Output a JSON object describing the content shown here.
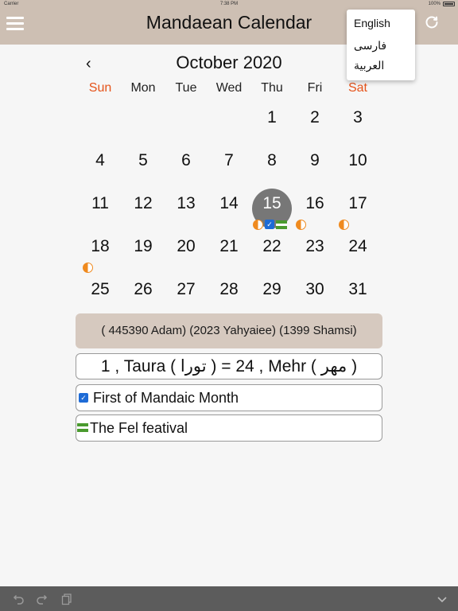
{
  "status_bar": {
    "carrier": "Carrier",
    "time": "7:38 PM",
    "battery": "100%"
  },
  "navbar": {
    "title": "Mandaean Calendar",
    "menu_icon": "hamburger-menu-icon",
    "refresh_icon": "refresh-icon"
  },
  "language_menu": {
    "items": [
      "English",
      "فارسی",
      "العربية"
    ]
  },
  "calendar": {
    "month_title": "October 2020",
    "prev_icon": "chevron-left-icon",
    "weekdays": [
      "Sun",
      "Mon",
      "Tue",
      "Wed",
      "Thu",
      "Fri",
      "Sat"
    ],
    "days": [
      "1",
      "2",
      "3",
      "4",
      "5",
      "6",
      "7",
      "8",
      "9",
      "10",
      "11",
      "12",
      "13",
      "14",
      "15",
      "16",
      "17",
      "18",
      "19",
      "20",
      "21",
      "22",
      "23",
      "24",
      "25",
      "26",
      "27",
      "28",
      "29",
      "30",
      "31"
    ],
    "selected_day": "15"
  },
  "info": {
    "era_line": "( 445390 Adam)  (2023 Yahyaiee)  (1399 Shamsi)",
    "conversion_line": "1 , Taura ( تورا )   =  24 , Mehr ( مهر )"
  },
  "events": [
    {
      "label": "First of Mandaic Month",
      "icon": "checkbox-icon"
    },
    {
      "label": "The Fel featival",
      "icon": "fel-flag-icon"
    }
  ],
  "colors": {
    "bar": "#cdbfb3",
    "weekend": "#e5531a",
    "today": "#777777",
    "moon": "#ef8a1f",
    "check": "#1e6bd6",
    "fel": "#4a9a2e",
    "toolbar": "#5c5c5c"
  },
  "toolbar": {
    "icons": [
      "undo-icon",
      "redo-icon",
      "copy-icon",
      "chevron-down-icon"
    ]
  }
}
